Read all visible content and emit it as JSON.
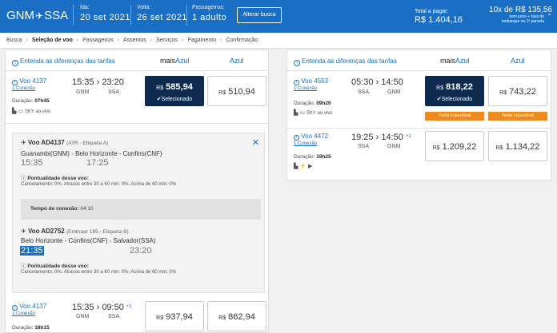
{
  "header": {
    "origin": "GNM",
    "destination": "SSA",
    "departure_label": "Ida:",
    "departure_value": "20 set 2021",
    "return_label": "Volta:",
    "return_value": "26 set 2021",
    "passengers_label": "Passageiros:",
    "passengers_value": "1 adulto",
    "alter_button": "Alterar busca",
    "total_label": "Total a pagar:",
    "total_value": "R$ 1.404,16",
    "installments_main": "10x de R$ 135,56",
    "installments_line1": "sem juros + taxa de",
    "installments_line2": "embarque na 1ª parcela"
  },
  "breadcrumb": [
    "Busca",
    "Seleção de voo",
    "Passageiros",
    "Assentos",
    "Serviços",
    "Pagamento",
    "Confirmação"
  ],
  "tabs": {
    "diff_label": "Entenda as diferenças das tarifas",
    "mais_prefix": "mais",
    "mais_brand": "Azul",
    "azul": "Azul"
  },
  "outbound": [
    {
      "flight_no": "Voo 4137",
      "connection": "1 Conexão",
      "dep_time": "15:35",
      "arr_time": "23:20",
      "dep_code": "GNM",
      "arr_code": "SSA",
      "duration_label": "Duração:",
      "duration": "07h45",
      "amenity": "SKY ao vivo",
      "fare_mais": "585,94",
      "fare_azul": "510,94",
      "selected_label": "Selecionado"
    },
    {
      "flight_no": "Voo 4137",
      "connection": "1 Conexão",
      "dep_time": "15:35",
      "arr_time": "09:50",
      "plus_day": "+1",
      "dep_code": "GNM",
      "arr_code": "SSA",
      "duration_label": "Duração:",
      "duration": "18h15",
      "fare_mais": "937,94",
      "fare_azul": "862,94"
    }
  ],
  "details": {
    "seg1_title": "Voo AD4137",
    "seg1_sub": "(ATR - Etiqueta A)",
    "seg1_from": "Guanambi(GNM)",
    "seg1_to": "Belo Horizonte - Confins(CNF)",
    "seg1_dep": "15:35",
    "seg1_arr": "17:25",
    "punct_label": "Pontualidade desse voo:",
    "cancel_text": "Cancelamento: 0%. Atrasos entre 30 a 60 min: 0%. Acima de 60 min: 0%",
    "conn_label": "Tempo de conexão:",
    "conn_value": "04:10",
    "seg2_title": "Voo AD2752",
    "seg2_sub": "(Embraer 195 - Etiqueta B)",
    "seg2_from": "Belo Horizonte - Confins(CNF)",
    "seg2_to": "Salvador(SSA)",
    "seg2_dep": "21:35",
    "seg2_arr": "23:20"
  },
  "return": [
    {
      "flight_no": "Voo 4553",
      "connection": "1 Conexão",
      "dep_time": "05:30",
      "arr_time": "14:50",
      "dep_code": "SSA",
      "arr_code": "GNM",
      "duration_label": "Duração:",
      "duration": "09h20",
      "amenity": "SKY ao vivo",
      "fare_mais": "818,22",
      "fare_azul": "743,22",
      "selected_label": "Selecionado",
      "tag_mais": "Tarifa imperdível",
      "tag_azul": "Tarifa imperdível"
    },
    {
      "flight_no": "Voo 4472",
      "connection": "1 Conexão",
      "dep_time": "19:25",
      "arr_time": "14:50",
      "plus_day": "+1",
      "dep_code": "SSA",
      "arr_code": "GNM",
      "duration_label": "Duração:",
      "duration": "19h25",
      "fare_mais": "1.209,22",
      "fare_azul": "1.134,22"
    }
  ],
  "currency": "R$",
  "colors": {
    "brand": "#1a6fc4",
    "selected": "#0e2a4f",
    "tag": "#f08a1c"
  }
}
